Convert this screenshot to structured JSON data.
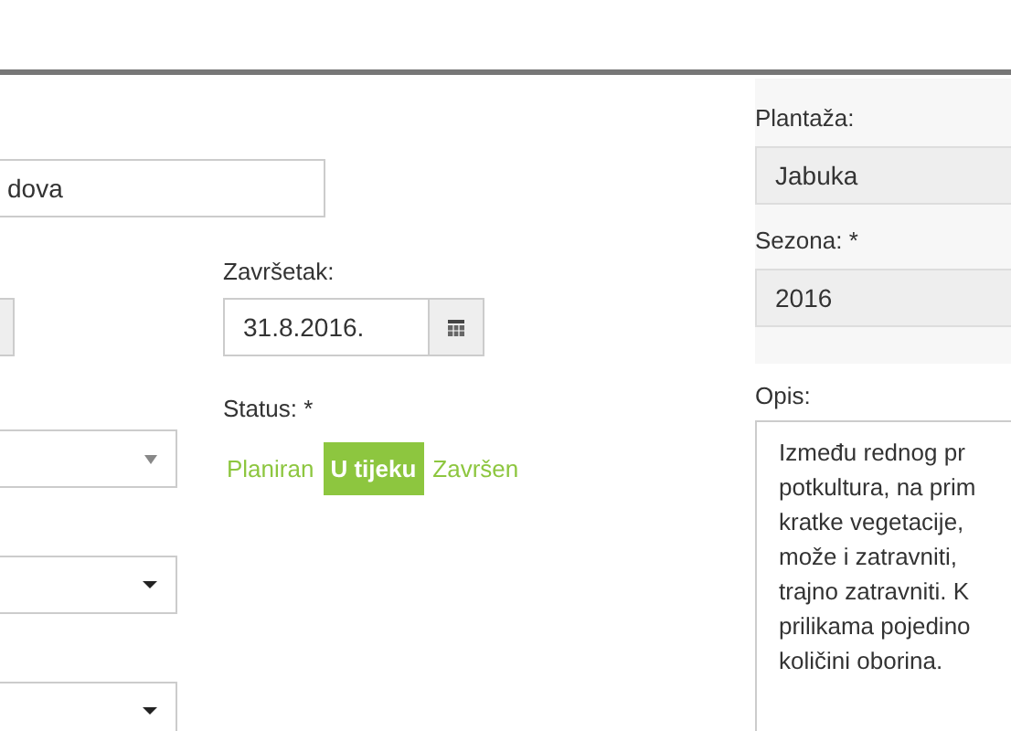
{
  "name_field": {
    "value": "dova"
  },
  "end_date": {
    "label": "Završetak:",
    "value": "31.8.2016."
  },
  "status": {
    "label": "Status: *",
    "options": [
      {
        "label": "Planiran",
        "selected": false
      },
      {
        "label": "U tijeku",
        "selected": true
      },
      {
        "label": "Završen",
        "selected": false
      }
    ]
  },
  "selects": [
    {
      "kind": "light"
    },
    {
      "kind": "dark"
    },
    {
      "kind": "dark"
    }
  ],
  "plantation": {
    "label": "Plantaža:",
    "value": "Jabuka"
  },
  "season": {
    "label": "Sezona: *",
    "value": "2016"
  },
  "description": {
    "label": "Opis:",
    "lines": [
      "Između rednog pr",
      "potkultura, na prim",
      "kratke vegetacije,",
      "može i zatravniti,",
      "trajno zatravniti. K",
      "prilikama pojedino",
      "količini oborina."
    ]
  }
}
